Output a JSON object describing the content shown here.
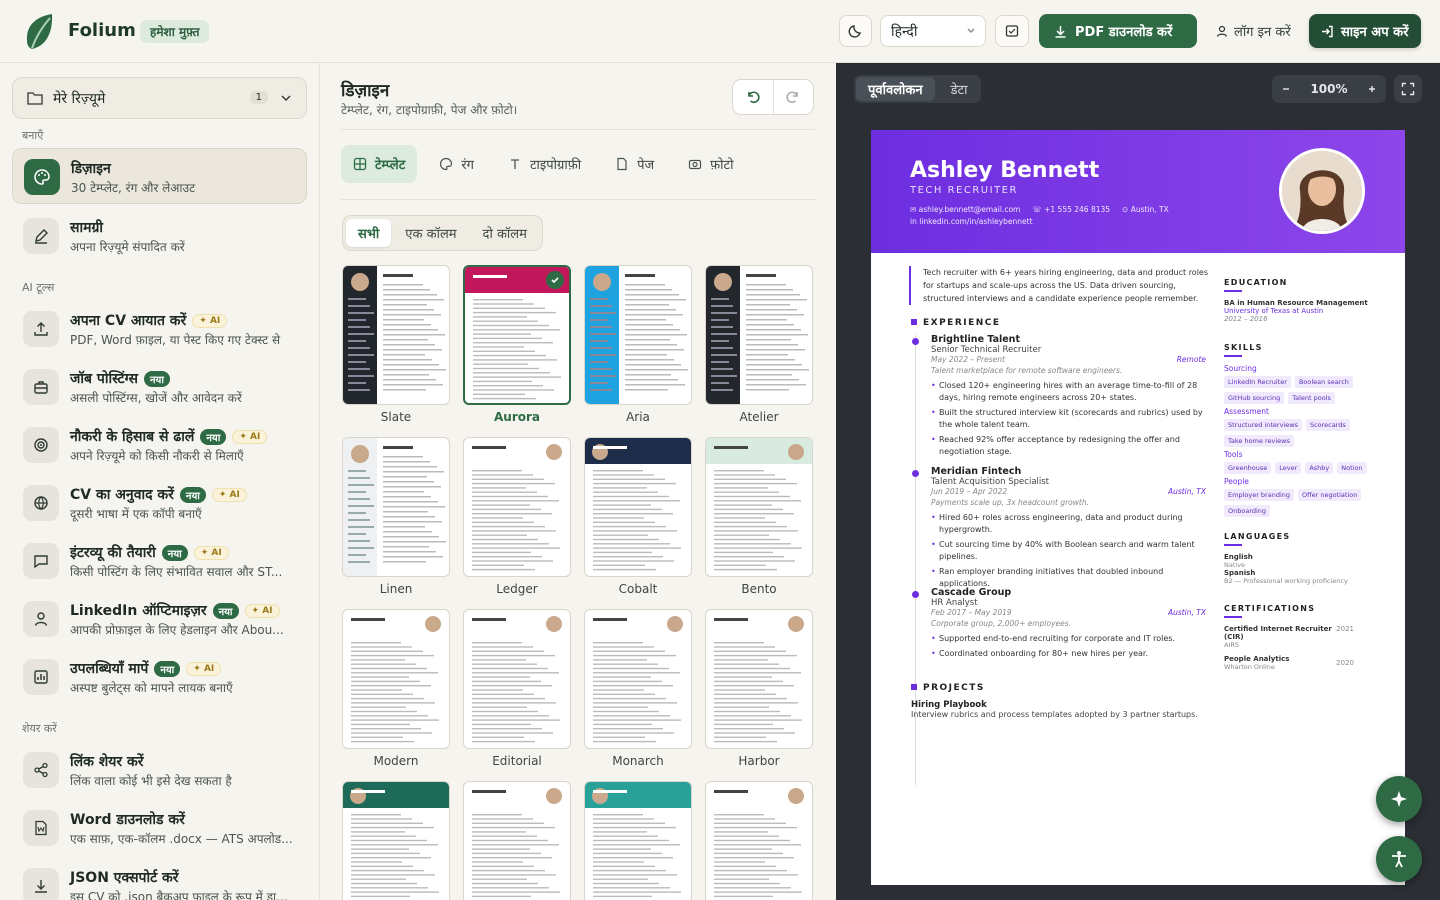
{
  "header": {
    "brand": "Folium",
    "badge": "हमेशा मुफ़्त",
    "language": "हिन्दी",
    "pdf_button": "PDF डाउनलोड करें",
    "login": "लॉग इन करें",
    "signup": "साइन अप करें"
  },
  "sidebar": {
    "my_resumes": "मेरे रिज़्यूमे",
    "resume_count": "1",
    "section_create": "बनाएँ",
    "section_ai": "AI टूल्स",
    "section_share": "शेयर करें",
    "new_badge": "नया",
    "ai_badge": "✦ AI",
    "items": [
      {
        "title": "डिज़ाइन",
        "sub": "30 टेम्प्लेट, रंग और लेआउट",
        "icon": "palette-icon"
      },
      {
        "title": "सामग्री",
        "sub": "अपना रिज़्यूमे संपादित करें",
        "icon": "pencil-icon"
      },
      {
        "title": "अपना CV आयात करें",
        "sub": "PDF, Word फ़ाइल, या पेस्ट किए गए टेक्स्ट से",
        "icon": "upload-icon"
      },
      {
        "title": "जॉब पोस्टिंग्स",
        "sub": "असली पोस्टिंग्स, खोजें और आवेदन करें",
        "icon": "briefcase-icon"
      },
      {
        "title": "नौकरी के हिसाब से ढालें",
        "sub": "अपने रिज़्यूमे को किसी नौकरी से मिलाएँ",
        "icon": "target-icon"
      },
      {
        "title": "CV का अनुवाद करें",
        "sub": "दूसरी भाषा में एक कॉपी बनाएँ",
        "icon": "globe-icon"
      },
      {
        "title": "इंटरव्यू की तैयारी",
        "sub": "किसी पोस्टिंग के लिए संभावित सवाल और ST...",
        "icon": "chat-icon"
      },
      {
        "title": "LinkedIn ऑप्टिमाइज़र",
        "sub": "आपकी प्रोफ़ाइल के लिए हेडलाइन और Abou...",
        "icon": "user-icon"
      },
      {
        "title": "उपलब्धियाँ मापें",
        "sub": "अस्पष्ट बुलेट्स को मापने लायक बनाएँ",
        "icon": "chart-icon"
      },
      {
        "title": "लिंक शेयर करें",
        "sub": "लिंक वाला कोई भी इसे देख सकता है",
        "icon": "share-icon"
      },
      {
        "title": "Word डाउनलोड करें",
        "sub": "एक साफ़, एक-कॉलम .docx — ATS अपलोड...",
        "icon": "word-icon"
      },
      {
        "title": "JSON एक्सपोर्ट करें",
        "sub": "इस CV को .json बैकअप फ़ाइल के रूप में डा...",
        "icon": "download-icon"
      }
    ]
  },
  "design": {
    "title": "डिज़ाइन",
    "subtitle": "टेम्प्लेट, रंग, टाइपोग्राफ़ी, पेज और फ़ोटो।",
    "tabs": [
      "टेम्प्लेट",
      "रंग",
      "टाइपोग्राफ़ी",
      "पेज",
      "फ़ोटो"
    ],
    "filters": [
      "सभी",
      "एक कॉलम",
      "दो कॉलम"
    ],
    "templates": [
      "Slate",
      "Aurora",
      "Aria",
      "Atelier",
      "Linen",
      "Ledger",
      "Cobalt",
      "Bento",
      "Modern",
      "Editorial",
      "Monarch",
      "Harbor"
    ],
    "selected_template": "Aurora"
  },
  "preview": {
    "tabs": [
      "पूर्वावलोकन",
      "डेटा"
    ],
    "zoom": "100%",
    "accent": "#6d2ee0",
    "resume": {
      "name": "Ashley Bennett",
      "role": "TECH RECRUITER",
      "email": "ashley.bennett@email.com",
      "phone": "+1 555 246 8135",
      "location": "Austin, TX",
      "linkedin": "linkedin.com/in/ashleybennett",
      "summary_1": "Tech recruiter with 6+ years hiring engineering, data and product roles for startups and scale-ups across the US. Data driven sourcing, structured interviews and a candidate experience people remember.",
      "experience_label": "EXPERIENCE",
      "jobs": [
        {
          "company": "Brightline Talent",
          "title": "Senior Technical Recruiter",
          "dates": "May 2022 – Present",
          "place": "Remote",
          "desc": "Talent marketplace for remote software engineers.",
          "bullets": [
            "Closed 120+ engineering hires with an average time-to-fill of 28 days, hiring remote engineers across 20+ states.",
            "Built the structured interview kit (scorecards and rubrics) used by the whole talent team.",
            "Reached 92% offer acceptance by redesigning the offer and negotiation stage."
          ]
        },
        {
          "company": "Meridian Fintech",
          "title": "Talent Acquisition Specialist",
          "dates": "Jun 2019 – Apr 2022",
          "place": "Austin, TX",
          "desc": "Payments scale up, 3x headcount growth.",
          "bullets": [
            "Hired 60+ roles across engineering, data and product during hypergrowth.",
            "Cut sourcing time by 40% with Boolean search and warm talent pipelines.",
            "Ran employer branding initiatives that doubled inbound applications."
          ]
        },
        {
          "company": "Cascade Group",
          "title": "HR Analyst",
          "dates": "Feb 2017 – May 2019",
          "place": "Austin, TX",
          "desc": "Corporate group, 2,000+ employees.",
          "bullets": [
            "Supported end-to-end recruiting for corporate and IT roles.",
            "Coordinated onboarding for 80+ new hires per year."
          ]
        }
      ],
      "projects_label": "PROJECTS",
      "project_title": "Hiring Playbook",
      "project_desc": "Interview rubrics and process templates adopted by 3 partner startups.",
      "education_label": "EDUCATION",
      "degree": "BA in Human Resource Management",
      "school": "University of Texas at Austin",
      "edu_years": "2012 – 2016",
      "skills_label": "SKILLS",
      "skill_groups": [
        {
          "name": "Sourcing",
          "items": [
            "LinkedIn Recruiter",
            "Boolean search",
            "GitHub sourcing",
            "Talent pools"
          ]
        },
        {
          "name": "Assessment",
          "items": [
            "Structured interviews",
            "Scorecards",
            "Take home reviews"
          ]
        },
        {
          "name": "Tools",
          "items": [
            "Greenhouse",
            "Lever",
            "Ashby",
            "Notion"
          ]
        },
        {
          "name": "People",
          "items": [
            "Employer branding",
            "Offer negotiation",
            "Onboarding"
          ]
        }
      ],
      "languages_label": "LANGUAGES",
      "lang1": "English",
      "lang1_level": "Native",
      "lang2": "Spanish",
      "lang2_level": "B2 — Professional working proficiency",
      "certs_label": "CERTIFICATIONS",
      "cert1": "Certified Internet Recruiter (CIR)",
      "cert1_org": "AIRS",
      "cert1_year": "2021",
      "cert2": "People Analytics",
      "cert2_org": "Wharton Online",
      "cert2_year": "2020"
    }
  }
}
